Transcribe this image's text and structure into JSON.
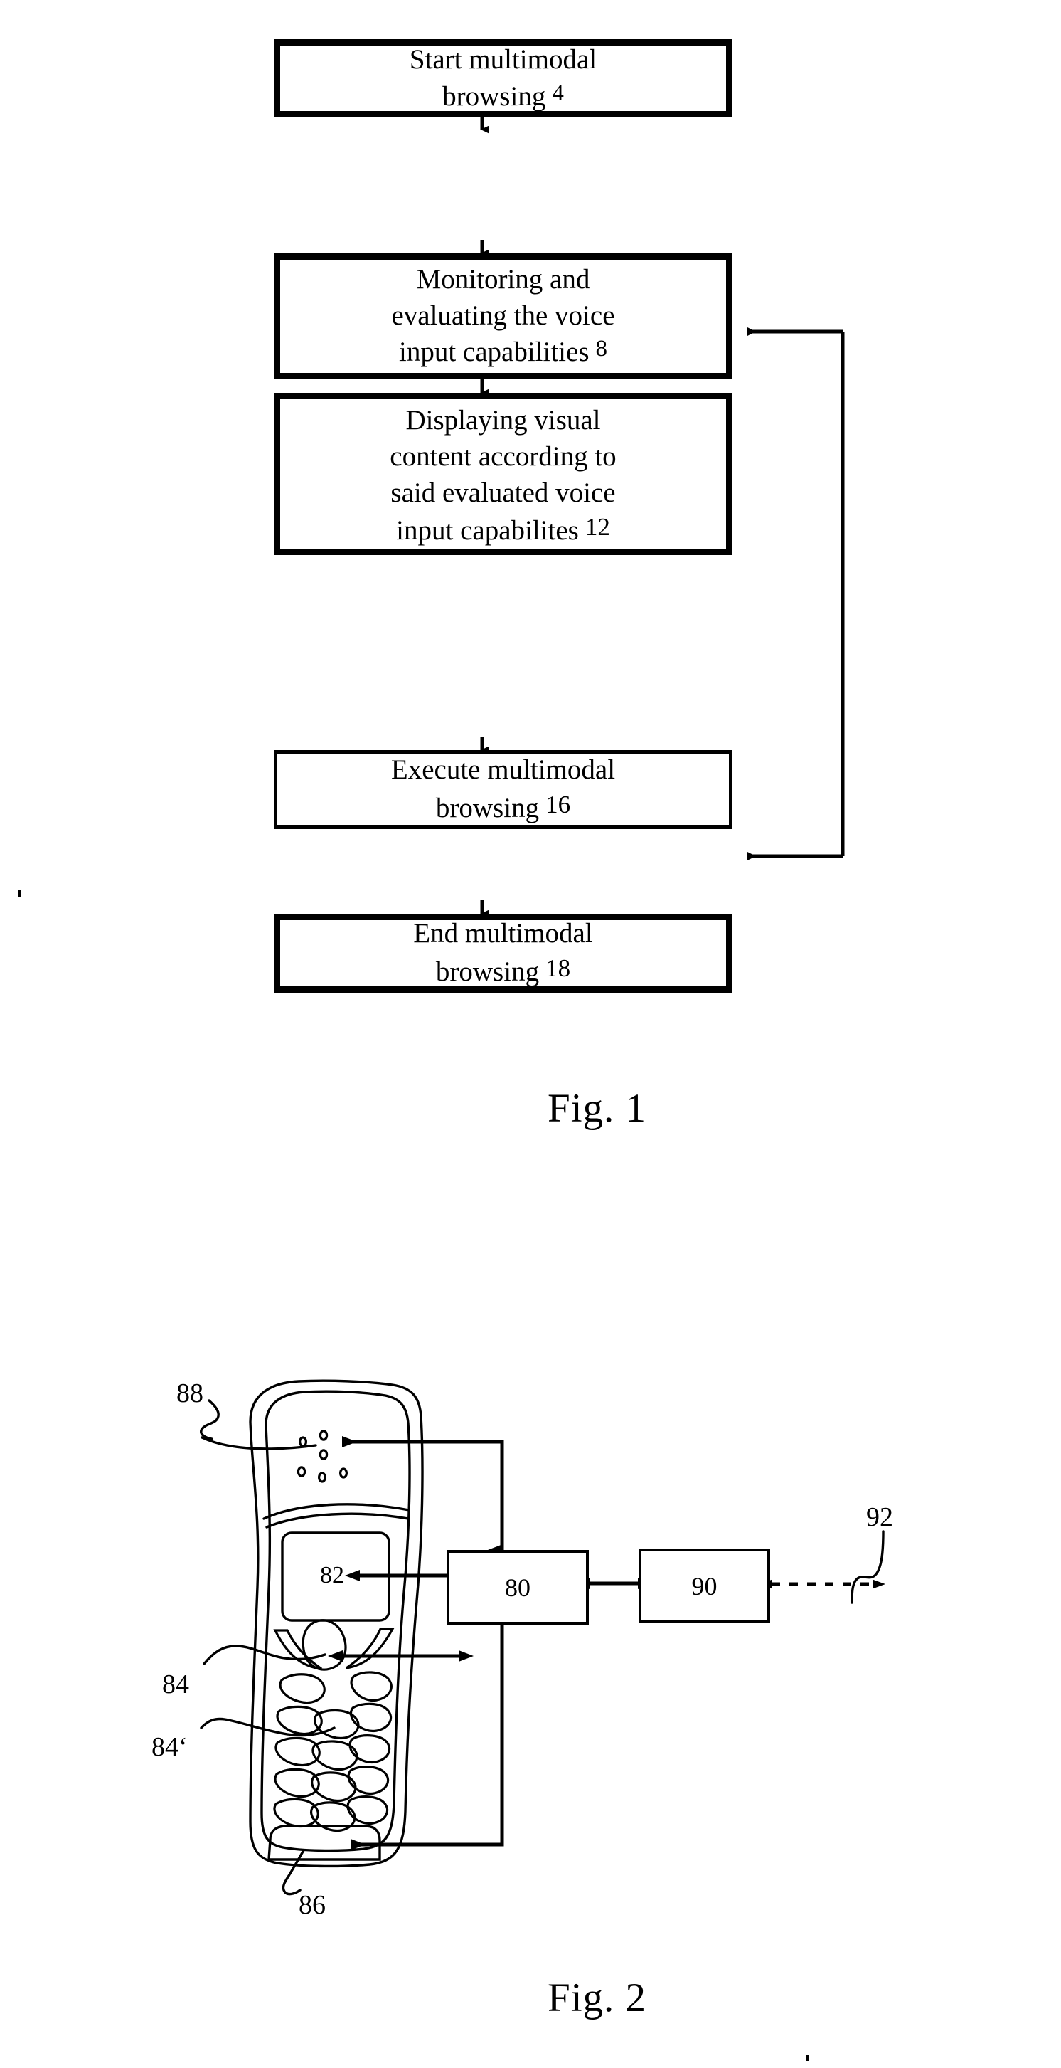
{
  "document": {
    "kind": "patent-figure-sheet",
    "figures": [
      "Fig. 1",
      "Fig. 2"
    ]
  },
  "figure1": {
    "caption": "Fig. 1",
    "type": "flowchart",
    "steps": [
      {
        "id": "start",
        "lines": [
          "Start multimodal",
          "browsing"
        ],
        "ref": "4",
        "border": "thick"
      },
      {
        "id": "monitor",
        "lines": [
          "Monitoring and",
          "evaluating the voice",
          "input capabilities"
        ],
        "ref": "8",
        "border": "thick"
      },
      {
        "id": "display",
        "lines": [
          "Displaying visual",
          "content according to",
          "said evaluated voice",
          "input capabilites"
        ],
        "ref": "12",
        "border": "thick"
      },
      {
        "id": "execute",
        "lines": [
          "Execute multimodal",
          "browsing"
        ],
        "ref": "16",
        "border": "thin"
      },
      {
        "id": "end",
        "lines": [
          "End multimodal",
          "browsing"
        ],
        "ref": "18",
        "border": "thick"
      }
    ],
    "flow_arrows": [
      {
        "from": "start",
        "to": "monitor",
        "direction": "down"
      },
      {
        "from": "monitor",
        "to": "display",
        "direction": "down"
      },
      {
        "from": "display",
        "to": "execute",
        "direction": "down"
      },
      {
        "from": "execute",
        "to": "end",
        "direction": "down"
      }
    ],
    "feedback_loop": {
      "description": "return path on the right side joining the execute step back to the monitor step",
      "targets": [
        "monitor",
        "execute"
      ],
      "arrowheads": "both-ends-pointing-left"
    }
  },
  "figure2": {
    "caption": "Fig. 2",
    "type": "block-diagram-with-device",
    "device": {
      "name": "mobile-handset",
      "parts": [
        {
          "ref": "88",
          "name": "speaker",
          "label": "88"
        },
        {
          "ref": "82",
          "name": "display",
          "label": "82",
          "in_shape_label": "82"
        },
        {
          "ref": "84",
          "name": "navigation-key",
          "label": "84"
        },
        {
          "ref": "84'",
          "name": "keypad-key",
          "label": "84‘"
        },
        {
          "ref": "86",
          "name": "microphone",
          "label": "86"
        }
      ],
      "keypad_rows": 5,
      "speaker_holes": 6
    },
    "blocks": [
      {
        "ref": "80",
        "label": "80",
        "name": "controller-block"
      },
      {
        "ref": "90",
        "label": "90",
        "name": "transceiver-block"
      }
    ],
    "wireless": {
      "ref": "92",
      "label": "92",
      "style": "dashed-double-arrow"
    },
    "connections": [
      {
        "from": "80",
        "to": "88",
        "style": "solid",
        "arrow": "single"
      },
      {
        "from": "80",
        "to": "82",
        "style": "solid",
        "arrow": "double"
      },
      {
        "from": "80",
        "to": "84",
        "style": "solid",
        "arrow": "double"
      },
      {
        "from": "80",
        "to": "86",
        "style": "solid",
        "arrow": "single"
      },
      {
        "from": "80",
        "to": "90",
        "style": "solid",
        "arrow": "double"
      },
      {
        "from": "90",
        "to": "92",
        "style": "dashed",
        "arrow": "double"
      }
    ]
  }
}
